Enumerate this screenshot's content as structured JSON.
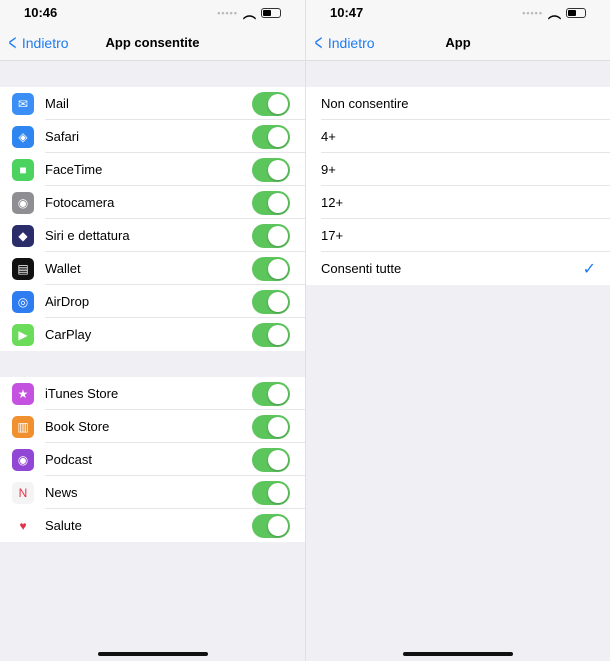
{
  "left": {
    "time": "10:46",
    "back": "Indietro",
    "title": "App consentite",
    "group1": [
      {
        "label": "Mail",
        "icon": "mail-icon",
        "color": "#3a8ef5",
        "glyph": "✉",
        "on": true
      },
      {
        "label": "Safari",
        "icon": "safari-icon",
        "color": "#2f86f0",
        "glyph": "◈",
        "on": true
      },
      {
        "label": "FaceTime",
        "icon": "facetime-icon",
        "color": "#4bd25f",
        "glyph": "■",
        "on": true
      },
      {
        "label": "Fotocamera",
        "icon": "camera-icon",
        "color": "#8e8e93",
        "glyph": "◉",
        "on": true
      },
      {
        "label": "Siri e dettatura",
        "icon": "siri-icon",
        "color": "#2a2d6a",
        "glyph": "◆",
        "on": true
      },
      {
        "label": "Wallet",
        "icon": "wallet-icon",
        "color": "#111111",
        "glyph": "▤",
        "on": true
      },
      {
        "label": "AirDrop",
        "icon": "airdrop-icon",
        "color": "#2d7cf0",
        "glyph": "◎",
        "on": true
      },
      {
        "label": "CarPlay",
        "icon": "carplay-icon",
        "color": "#6bdc5a",
        "glyph": "▶",
        "on": true
      }
    ],
    "group2": [
      {
        "label": "iTunes Store",
        "icon": "itunes-store-icon",
        "color": "#c451e0",
        "glyph": "★",
        "on": true
      },
      {
        "label": "Book Store",
        "icon": "book-store-icon",
        "color": "#f0902e",
        "glyph": "▥",
        "on": true
      },
      {
        "label": "Podcast",
        "icon": "podcast-icon",
        "color": "#9146d6",
        "glyph": "◉",
        "on": true
      },
      {
        "label": "News",
        "icon": "news-icon",
        "color": "#f4f4f4",
        "glyph": "N",
        "on": true
      },
      {
        "label": "Salute",
        "icon": "health-icon",
        "color": "#ffffff",
        "glyph": "♥",
        "on": true
      }
    ]
  },
  "right": {
    "time": "10:47",
    "back": "Indietro",
    "title": "App",
    "options": [
      {
        "label": "Non consentire"
      },
      {
        "label": "4+"
      },
      {
        "label": "9+"
      },
      {
        "label": "12+"
      },
      {
        "label": "17+"
      },
      {
        "label": "Consenti tutte",
        "selected": true
      }
    ],
    "check": "✓"
  }
}
